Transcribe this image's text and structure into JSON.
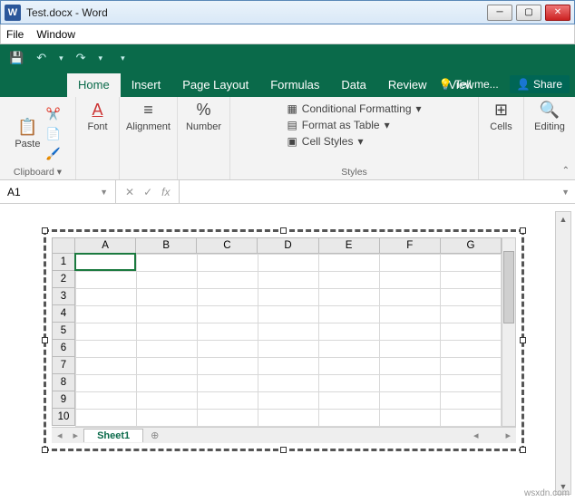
{
  "window": {
    "app_glyph": "W",
    "title": "Test.docx - Word",
    "buttons": {
      "min": "─",
      "max": "▢",
      "close": "✕"
    }
  },
  "menubar": {
    "file": "File",
    "window": "Window"
  },
  "qat": {
    "save": "💾",
    "undo": "↶",
    "redo": "↷",
    "more": "▾"
  },
  "tabs": {
    "home": "Home",
    "insert": "Insert",
    "page_layout": "Page Layout",
    "formulas": "Formulas",
    "data": "Data",
    "review": "Review",
    "view": "View",
    "tell_me": "Tell me...",
    "share": "Share"
  },
  "ribbon": {
    "clipboard": {
      "label": "Clipboard",
      "paste": "Paste"
    },
    "font": {
      "label": "Font",
      "btn": "Font"
    },
    "alignment": {
      "label": "Alignment",
      "btn": "Alignment"
    },
    "number": {
      "label": "Number",
      "btn": "Number"
    },
    "styles": {
      "label": "Styles",
      "cond": "Conditional Formatting",
      "table": "Format as Table",
      "cell": "Cell Styles"
    },
    "cells": {
      "label": "Cells",
      "btn": "Cells"
    },
    "editing": {
      "label": "Editing",
      "btn": "Editing"
    }
  },
  "formula_bar": {
    "name": "A1",
    "cancel": "✕",
    "enter": "✓",
    "fx": "fx",
    "value": ""
  },
  "sheet": {
    "cols": [
      "A",
      "B",
      "C",
      "D",
      "E",
      "F",
      "G"
    ],
    "rows": [
      "1",
      "2",
      "3",
      "4",
      "5",
      "6",
      "7",
      "8",
      "9",
      "10"
    ],
    "tab": "Sheet1",
    "add": "⊕"
  },
  "watermark": "wsxdn.com"
}
